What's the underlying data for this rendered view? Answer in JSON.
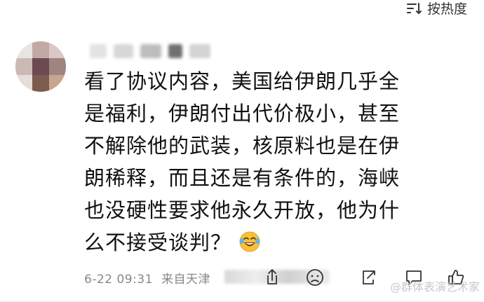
{
  "sort": {
    "label": "按热度",
    "icon": "sort-icon"
  },
  "comment": {
    "lines": [
      "看了协议内容，美国给伊朗几乎全",
      "是福利，伊朗付出代价极小，甚至",
      "不解除他的武装，核原料也是在伊",
      "朗稀释，而且还是有条件的，海峡",
      "也没硬性要求他永久开放，他为什",
      "么不接受谈判？"
    ],
    "emoji": "laughing-tears-emoji"
  },
  "footer": {
    "timestamp": "6-22 09:31",
    "source": "来自天津",
    "actions": [
      "share-icon",
      "dislike-face-icon",
      "reply-icon",
      "comment-icon",
      "like-icon"
    ]
  },
  "watermark": "@群体表演艺术家",
  "colors": {
    "text": "#111111",
    "meta": "#888888",
    "icon": "#333333"
  }
}
